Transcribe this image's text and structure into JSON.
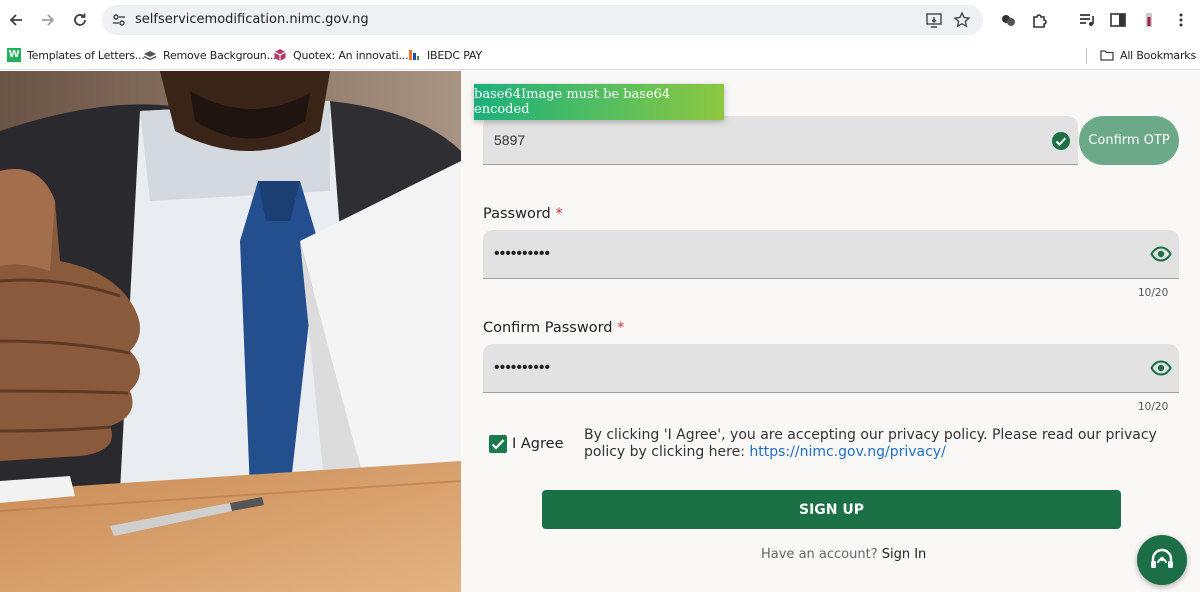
{
  "browser": {
    "url": "selfservicemodification.nimc.gov.ng",
    "bookmarks": [
      {
        "label": "Templates of Letters...",
        "icon": "w-favicon"
      },
      {
        "label": "Remove Backgroun...",
        "icon": "layers-favicon"
      },
      {
        "label": "Quotex: An innovati...",
        "icon": "cube-favicon"
      },
      {
        "label": "IBEDC PAY",
        "icon": "ibedc-favicon"
      }
    ],
    "all_bookmarks": "All Bookmarks"
  },
  "toast": {
    "message": "base64Image must be base64 encoded"
  },
  "otp": {
    "value": "5897",
    "confirm_label": "Confirm OTP",
    "status": "verified"
  },
  "password": {
    "label": "Password",
    "required_mark": "*",
    "masked_value": "••••••••••",
    "counter": "10/20"
  },
  "confirm_password": {
    "label": "Confirm Password",
    "required_mark": "*",
    "masked_value": "••••••••••",
    "counter": "10/20"
  },
  "agree": {
    "label": "I Agree",
    "checked": true,
    "policy_text": "By clicking 'I Agree', you are accepting our privacy policy. Please read our privacy policy by clicking here: ",
    "policy_link": "https://nimc.gov.ng/privacy/"
  },
  "signup": {
    "label": "SIGN UP"
  },
  "signin": {
    "prompt": "Have an account?",
    "link": "Sign In"
  },
  "colors": {
    "primary": "#1c7046",
    "otp_button": "#6ba989",
    "required": "#d32f2f",
    "link": "#1e6fc9",
    "check": "#1a7a4c"
  }
}
